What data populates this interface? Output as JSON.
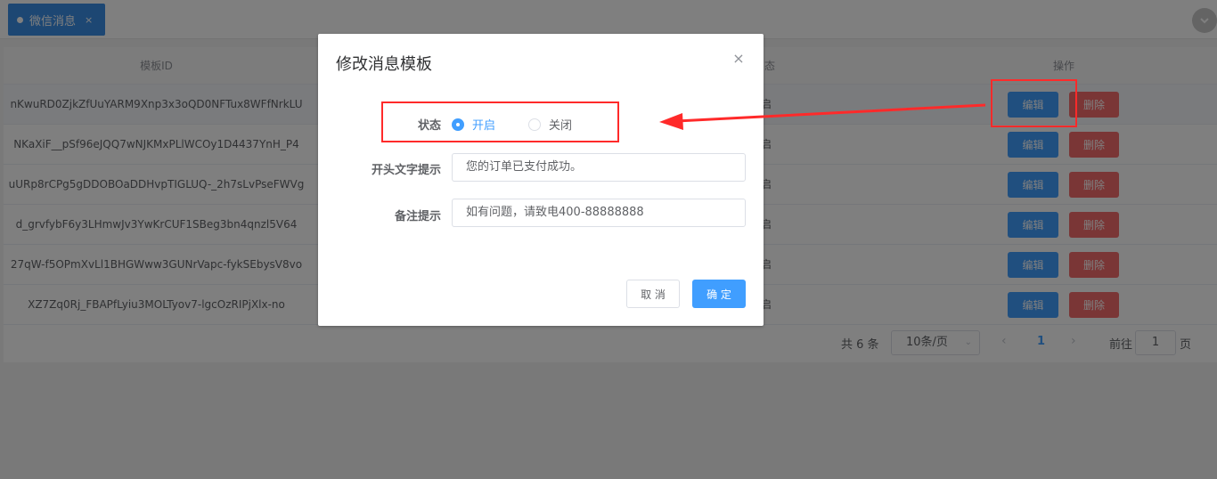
{
  "tabbar": {
    "active_tab_label": "微信消息",
    "active_tab_close": "×"
  },
  "table": {
    "headers": {
      "template_id": "模板ID",
      "status": "态",
      "actions": "操作"
    },
    "rows": [
      {
        "id": "nKwuRD0ZjkZfUuYARM9Xnp3x3oQD0NFTux8WFfNrkLU",
        "status": "启",
        "edit": "编辑",
        "delete": "删除"
      },
      {
        "id": "NKaXiF__pSf96eJQQ7wNJKMxPLlWCOy1D4437YnH_P4",
        "status": "启",
        "edit": "编辑",
        "delete": "删除"
      },
      {
        "id": "uURp8rCPg5gDDOBOaDDHvpTIGLUQ-_2h7sLvPseFWVg",
        "status": "启",
        "edit": "编辑",
        "delete": "删除"
      },
      {
        "id": "d_grvfybF6y3LHmwJv3YwKrCUF1SBeg3bn4qnzl5V64",
        "status": "启",
        "edit": "编辑",
        "delete": "删除"
      },
      {
        "id": "27qW-f5OPmXvLl1BHGWww3GUNrVapc-fykSEbysV8vo",
        "status": "启",
        "edit": "编辑",
        "delete": "删除"
      },
      {
        "id": "XZ7Zq0Rj_FBAPfLyiu3MOLTyov7-lgcOzRIPjXlx-no",
        "status": "启",
        "edit": "编辑",
        "delete": "删除"
      }
    ]
  },
  "pagination": {
    "total": "共 6 条",
    "page_size": "10条/页",
    "current_page": "1",
    "goto_label": "前往",
    "goto_value": "1",
    "page_unit": "页"
  },
  "dialog": {
    "title": "修改消息模板",
    "close": "×",
    "status_label": "状态",
    "status_options": [
      "开启",
      "关闭"
    ],
    "status_selected": "开启",
    "prefix_label": "开头文字提示",
    "prefix_value": "您的订单已支付成功。",
    "remark_label": "备注提示",
    "remark_value": "如有问题，请致电400-88888888",
    "cancel_label": "取 消",
    "confirm_label": "确 定"
  },
  "colors": {
    "primary": "#409eff",
    "danger": "#f56c6c",
    "annotation": "#ff2a2a"
  }
}
